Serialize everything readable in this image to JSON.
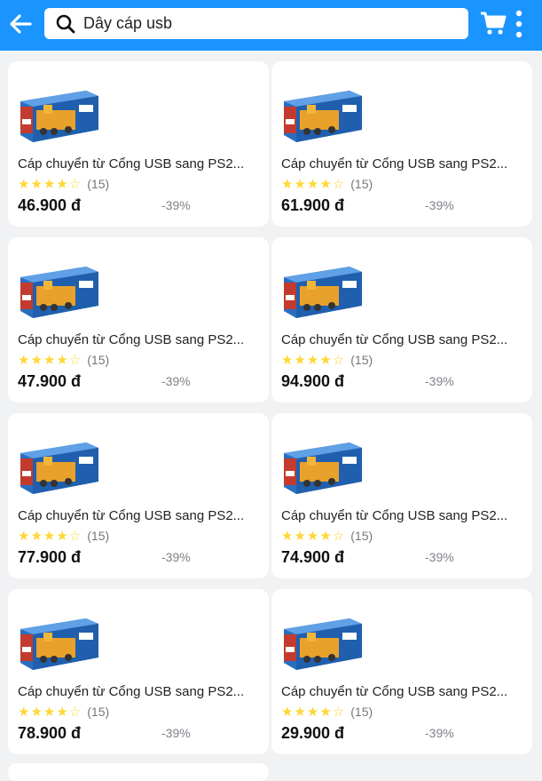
{
  "header": {
    "search_value": "Dây cáp usb",
    "back_icon": "arrow-left-icon",
    "cart_icon": "cart-icon",
    "more_icon": "kebab-menu-icon",
    "bar_color": "#1a94ff"
  },
  "products": [
    {
      "title": "Cáp chuyển từ Cổng USB sang PS2...",
      "stars": "★★★★☆",
      "reviews": "(15)",
      "price": "46.900 đ",
      "discount": "-39%"
    },
    {
      "title": "Cáp chuyển từ Cổng USB sang PS2...",
      "stars": "★★★★☆",
      "reviews": "(15)",
      "price": "61.900 đ",
      "discount": "-39%"
    },
    {
      "title": "Cáp chuyển từ Cổng USB sang PS2...",
      "stars": "★★★★☆",
      "reviews": "(15)",
      "price": "47.900 đ",
      "discount": "-39%"
    },
    {
      "title": "Cáp chuyển từ Cổng USB sang PS2...",
      "stars": "★★★★☆",
      "reviews": "(15)",
      "price": "94.900 đ",
      "discount": "-39%"
    },
    {
      "title": "Cáp chuyển từ Cổng USB sang PS2...",
      "stars": "★★★★☆",
      "reviews": "(15)",
      "price": "77.900 đ",
      "discount": "-39%"
    },
    {
      "title": "Cáp chuyển từ Cổng USB sang PS2...",
      "stars": "★★★★☆",
      "reviews": "(15)",
      "price": "74.900 đ",
      "discount": "-39%"
    },
    {
      "title": "Cáp chuyển từ Cổng USB sang PS2...",
      "stars": "★★★★☆",
      "reviews": "(15)",
      "price": "78.900 đ",
      "discount": "-39%"
    },
    {
      "title": "Cáp chuyển từ Cổng USB sang PS2...",
      "stars": "★★★★☆",
      "reviews": "(15)",
      "price": "29.900 đ",
      "discount": "-39%"
    }
  ]
}
